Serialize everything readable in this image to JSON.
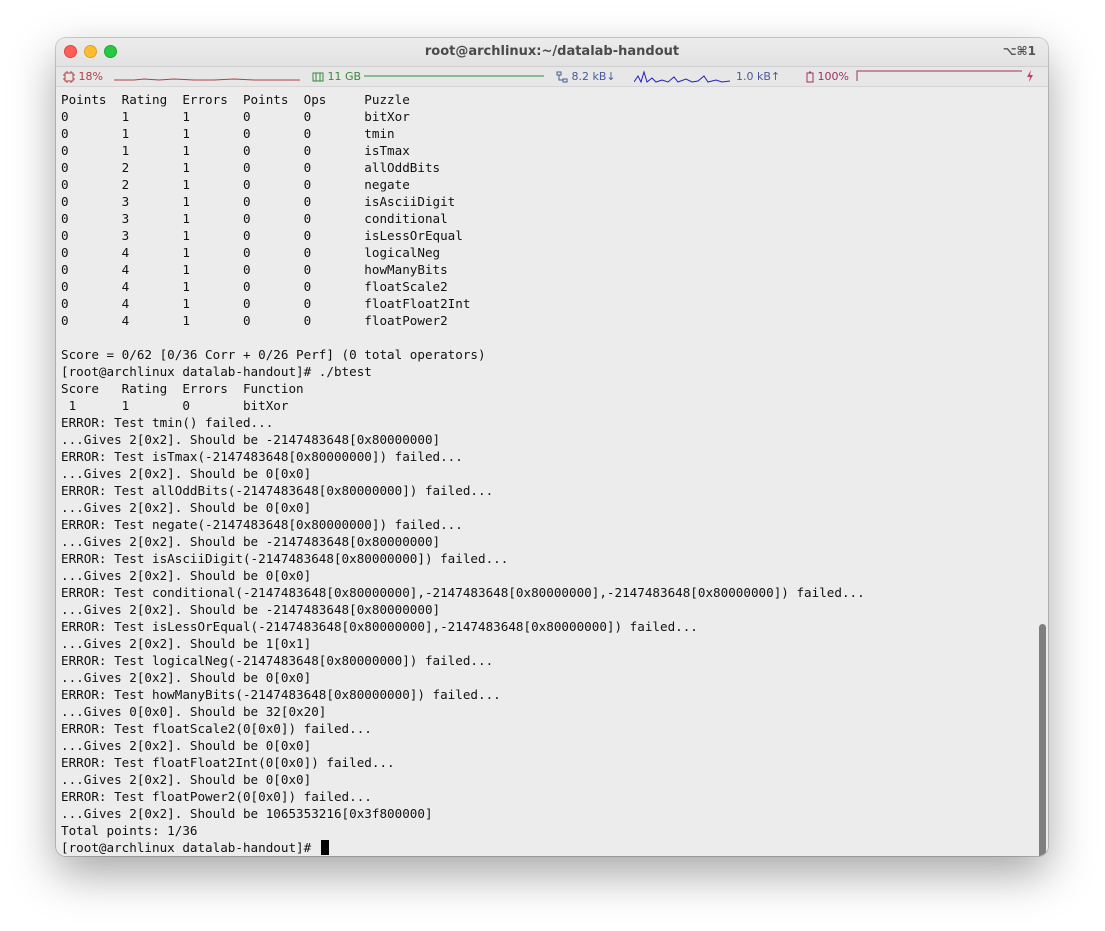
{
  "window": {
    "title": "root@archlinux:~/datalab-handout",
    "shortcut": "⌥⌘1"
  },
  "statusbar": {
    "cpu": "18%",
    "memory": "11 GB",
    "net_down": "8.2 kB↓",
    "net_up": "1.0 kB↑",
    "battery": "100%",
    "colors": {
      "cpu_graph": "#b04040",
      "mem_graph": "#3a8a3a",
      "net_graph": "#2020c0",
      "battery_graph": "#a03060"
    }
  },
  "terminal": {
    "lines": [
      "Points  Rating  Errors  Points  Ops     Puzzle",
      "0       1       1       0       0       bitXor",
      "0       1       1       0       0       tmin",
      "0       1       1       0       0       isTmax",
      "0       2       1       0       0       allOddBits",
      "0       2       1       0       0       negate",
      "0       3       1       0       0       isAsciiDigit",
      "0       3       1       0       0       conditional",
      "0       3       1       0       0       isLessOrEqual",
      "0       4       1       0       0       logicalNeg",
      "0       4       1       0       0       howManyBits",
      "0       4       1       0       0       floatScale2",
      "0       4       1       0       0       floatFloat2Int",
      "0       4       1       0       0       floatPower2",
      "",
      "Score = 0/62 [0/36 Corr + 0/26 Perf] (0 total operators)",
      "[root@archlinux datalab-handout]# ./btest",
      "Score   Rating  Errors  Function",
      " 1      1       0       bitXor",
      "ERROR: Test tmin() failed...",
      "...Gives 2[0x2]. Should be -2147483648[0x80000000]",
      "ERROR: Test isTmax(-2147483648[0x80000000]) failed...",
      "...Gives 2[0x2]. Should be 0[0x0]",
      "ERROR: Test allOddBits(-2147483648[0x80000000]) failed...",
      "...Gives 2[0x2]. Should be 0[0x0]",
      "ERROR: Test negate(-2147483648[0x80000000]) failed...",
      "...Gives 2[0x2]. Should be -2147483648[0x80000000]",
      "ERROR: Test isAsciiDigit(-2147483648[0x80000000]) failed...",
      "...Gives 2[0x2]. Should be 0[0x0]",
      "ERROR: Test conditional(-2147483648[0x80000000],-2147483648[0x80000000],-2147483648[0x80000000]) failed...",
      "...Gives 2[0x2]. Should be -2147483648[0x80000000]",
      "ERROR: Test isLessOrEqual(-2147483648[0x80000000],-2147483648[0x80000000]) failed...",
      "...Gives 2[0x2]. Should be 1[0x1]",
      "ERROR: Test logicalNeg(-2147483648[0x80000000]) failed...",
      "...Gives 2[0x2]. Should be 0[0x0]",
      "ERROR: Test howManyBits(-2147483648[0x80000000]) failed...",
      "...Gives 0[0x0]. Should be 32[0x20]",
      "ERROR: Test floatScale2(0[0x0]) failed...",
      "...Gives 2[0x2]. Should be 0[0x0]",
      "ERROR: Test floatFloat2Int(0[0x0]) failed...",
      "...Gives 2[0x2]. Should be 0[0x0]",
      "ERROR: Test floatPower2(0[0x0]) failed...",
      "...Gives 2[0x2]. Should be 1065353216[0x3f800000]",
      "Total points: 1/36"
    ],
    "prompt": "[root@archlinux datalab-handout]# "
  }
}
